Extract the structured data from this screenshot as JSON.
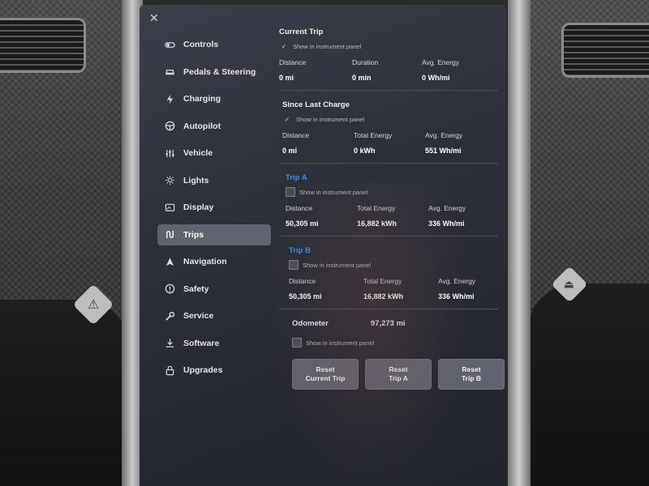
{
  "close_icon_glyph": "✕",
  "sidebar": {
    "items": [
      {
        "label": "Controls",
        "icon": "toggle-icon"
      },
      {
        "label": "Pedals & Steering",
        "icon": "car-icon"
      },
      {
        "label": "Charging",
        "icon": "bolt-icon"
      },
      {
        "label": "Autopilot",
        "icon": "steering-wheel-icon"
      },
      {
        "label": "Vehicle",
        "icon": "sliders-icon"
      },
      {
        "label": "Lights",
        "icon": "sun-icon"
      },
      {
        "label": "Display",
        "icon": "display-icon"
      },
      {
        "label": "Trips",
        "icon": "route-icon",
        "active": true
      },
      {
        "label": "Navigation",
        "icon": "navigation-arrow-icon"
      },
      {
        "label": "Safety",
        "icon": "alert-circle-icon"
      },
      {
        "label": "Service",
        "icon": "wrench-icon"
      },
      {
        "label": "Software",
        "icon": "download-icon"
      },
      {
        "label": "Upgrades",
        "icon": "lock-icon"
      }
    ]
  },
  "current_trip": {
    "title": "Current Trip",
    "checkbox_label": "Show in instrument panel",
    "checked": true,
    "stats": [
      {
        "label": "Distance",
        "value": "0 mi"
      },
      {
        "label": "Duration",
        "value": "0 min"
      },
      {
        "label": "Avg. Energy",
        "value": "0 Wh/mi"
      }
    ]
  },
  "since_last_charge": {
    "title": "Since Last Charge",
    "checkbox_label": "Show in instrument panel",
    "checked": true,
    "stats": [
      {
        "label": "Distance",
        "value": "0 mi"
      },
      {
        "label": "Total Energy",
        "value": "0 kWh"
      },
      {
        "label": "Avg. Energy",
        "value": "551 Wh/mi"
      }
    ]
  },
  "trip_a": {
    "title": "Trip A",
    "checkbox_label": "Show in instrument panel",
    "checked": false,
    "stats": [
      {
        "label": "Distance",
        "value": "50,305 mi"
      },
      {
        "label": "Total Energy",
        "value": "16,882 kWh"
      },
      {
        "label": "Avg. Energy",
        "value": "336 Wh/mi"
      }
    ]
  },
  "trip_b": {
    "title": "Trip B",
    "checkbox_label": "Show in instrument panel",
    "checked": false,
    "stats": [
      {
        "label": "Distance",
        "value": "50,305 mi"
      },
      {
        "label": "Total Energy",
        "value": "16,882 kWh"
      },
      {
        "label": "Avg. Energy",
        "value": "336 Wh/mi"
      }
    ]
  },
  "odometer": {
    "label": "Odometer",
    "value": "97,273 mi",
    "checkbox_label": "Show in instrument panel",
    "checked": false
  },
  "buttons": {
    "reset_current": [
      "Reset",
      "Current Trip"
    ],
    "reset_a": [
      "Reset",
      "Trip A"
    ],
    "reset_b": [
      "Reset",
      "Trip B"
    ]
  },
  "colors": {
    "accent_blue": "#3e8ee8",
    "active_nav_bg": "#5f6370"
  }
}
